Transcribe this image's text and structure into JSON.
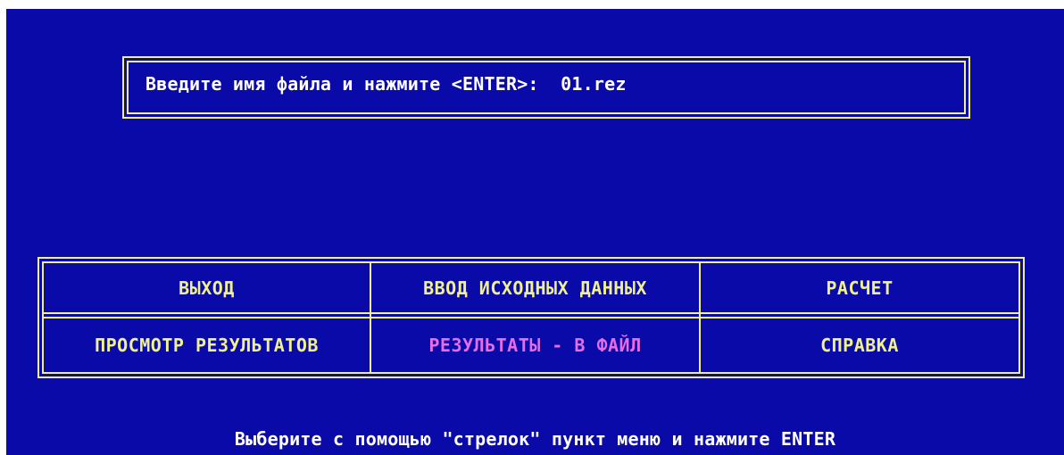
{
  "prompt": {
    "label": "Введите имя файла и нажмите <ENTER>:",
    "value": "01.rez"
  },
  "menu": {
    "items": [
      {
        "label": "ВЫХОД",
        "active": false
      },
      {
        "label": "ВВОД ИСХОДНЫХ ДАННЫХ",
        "active": false
      },
      {
        "label": "РАСЧЕТ",
        "active": false
      },
      {
        "label": "ПРОСМОТР РЕЗУЛЬТАТОВ",
        "active": false
      },
      {
        "label": "РЕЗУЛЬТАТЫ - В ФАЙЛ",
        "active": true
      },
      {
        "label": "СПРАВКА",
        "active": false
      }
    ]
  },
  "hint": "Выберите с помощью \"стрелок\" пункт меню и нажмите ENTER",
  "colors": {
    "background": "#0a0aa8",
    "frame": "#f2f28c",
    "menu_text": "#f2f28c",
    "active_text": "#e86be8",
    "text": "#ffffff"
  }
}
